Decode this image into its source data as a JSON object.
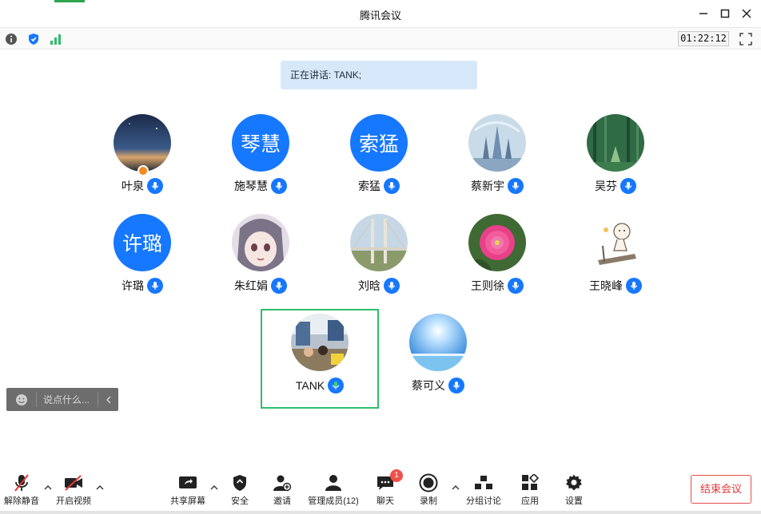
{
  "window": {
    "title": "腾讯会议"
  },
  "timer": "01:22:12",
  "speaking_text": "正在讲话: TANK;",
  "participants": [
    {
      "name": "叶泉",
      "avatar": "photo-night-sky",
      "host": true
    },
    {
      "name": "施琴慧",
      "avatar_text": "琴慧"
    },
    {
      "name": "索猛",
      "avatar_text": "索猛"
    },
    {
      "name": "蔡新宇",
      "avatar": "photo-fantasy-castle"
    },
    {
      "name": "吴芬",
      "avatar": "photo-forest"
    },
    {
      "name": "许璐",
      "avatar_text": "许璐"
    },
    {
      "name": "朱红娟",
      "avatar": "photo-anime-girl"
    },
    {
      "name": "刘晗",
      "avatar": "photo-bridge"
    },
    {
      "name": "王则徐",
      "avatar": "photo-pink-flower"
    },
    {
      "name": "王晓峰",
      "avatar": "photo-cartoon-treadmill"
    },
    {
      "name": "TANK",
      "avatar": "photo-exhibition",
      "speaking": true
    },
    {
      "name": "蔡可义",
      "avatar": "photo-sun-sky"
    }
  ],
  "chat": {
    "placeholder": "说点什么..."
  },
  "bottom": {
    "unmute": "解除静音",
    "video": "开启视频",
    "share": "共享屏幕",
    "security": "安全",
    "invite": "邀请",
    "members": "管理成员(12)",
    "chat": "聊天",
    "chat_badge": "1",
    "record": "录制",
    "breakout": "分组讨论",
    "apps": "应用",
    "settings": "设置",
    "end": "结束会议"
  },
  "colors": {
    "accent": "#1677ff",
    "end": "#e23636",
    "active_border": "#2ebd6b"
  }
}
